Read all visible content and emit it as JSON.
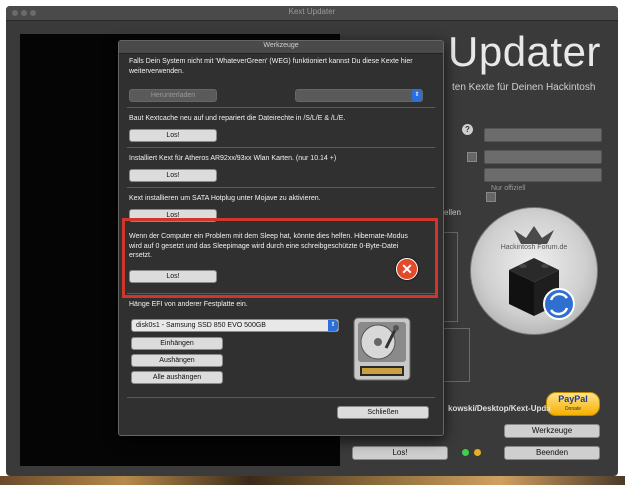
{
  "main_window": {
    "title": "Kext Updater",
    "app_title": "Updater",
    "app_subtitle": "ten Kexte für Deinen Hackintosh",
    "nur_label": "Nur offiziell",
    "partial_label": "ellen",
    "logo_text": "Hackintosh Forum.de",
    "path_text": "kowski/Desktop/Kext-Upda",
    "paypal": {
      "label": "PayPal",
      "sublabel": "Donate"
    },
    "werkzeuge_button": "Werkzeuge",
    "los_button": "Los!",
    "beenden_button": "Beenden"
  },
  "dialog": {
    "title": "Werkzeuge",
    "weg_text": "Falls Dein System nicht mit 'WhateverGreen' (WEG) funktioniert kannst Du diese Kexte hier weiterverwenden.",
    "weg_button": "Herunterladen",
    "weg_select": "",
    "cache_text": "Baut Kextcache neu auf und repariert die Dateirechte in /S/L/E & /L/E.",
    "cache_button": "Los!",
    "atheros_text": "Installiert Kext für Atheros AR92xx/93xx Wlan Karten. (nur 10.14 +)",
    "atheros_button": "Los!",
    "sata_text": "Kext installieren um SATA Hotplug unter Mojave zu aktivieren.",
    "sata_button": "Los!",
    "sleep_text": "Wenn der Computer ein Problem mit dem Sleep hat, könnte dies helfen. Hibernate-Modus wird auf 0 gesetzt und das Sleepimage wird durch eine schreibgeschützte 0-Byte-Datei ersetzt.",
    "sleep_button": "Los!",
    "efi_title": "Hänge EFI von anderer Festplatte ein.",
    "disk_select": "disk0s1 - Samsung SSD 850 EVO 500GB",
    "mount_button": "Einhängen",
    "unmount_button": "Aushängen",
    "unmount_all_button": "Alle aushängen",
    "close_button": "Schließen"
  },
  "colors": {
    "highlight_frame": "#d0362a",
    "select_accent": "#2d6fd8"
  }
}
